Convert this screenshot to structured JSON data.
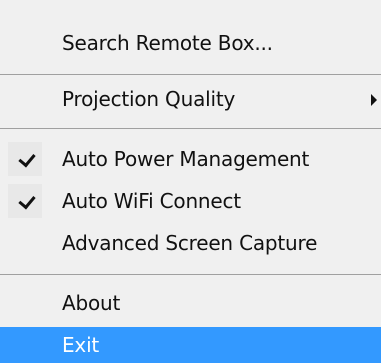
{
  "menu": {
    "items": [
      {
        "label": "Search Remote Box..."
      },
      {
        "label": "Projection Quality"
      },
      {
        "label": "Auto Power Management",
        "checked": true
      },
      {
        "label": "Auto WiFi Connect",
        "checked": true
      },
      {
        "label": "Advanced Screen Capture"
      },
      {
        "label": "About"
      },
      {
        "label": "Exit",
        "selected": true
      }
    ]
  },
  "colors": {
    "menu_background": "#f0f0f0",
    "highlight": "#3399ff",
    "text": "#111111",
    "separator": "#a0a0a0"
  },
  "icons": {
    "submenu": "chevron-right-icon",
    "check": "checkmark-icon"
  }
}
